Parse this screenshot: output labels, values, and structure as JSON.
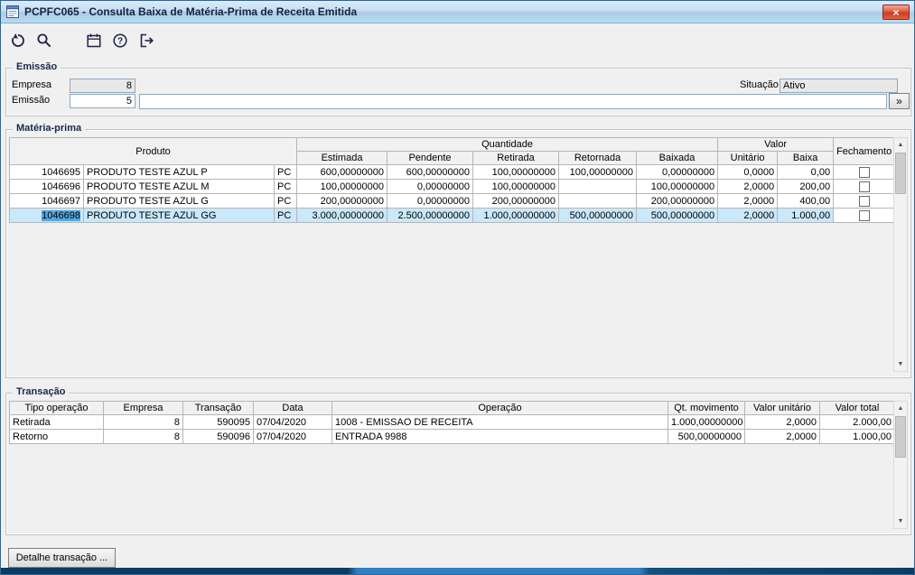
{
  "window": {
    "title": "PCPFC065 - Consulta Baixa de Matéria-Prima de Receita Emitida",
    "close_glyph": "×"
  },
  "toolbar": {
    "buttons": [
      "undo",
      "search",
      "calendar",
      "help",
      "exit"
    ]
  },
  "ui": {
    "expand_glyph": "»",
    "scroll_up_glyph": "▲",
    "scroll_down_glyph": "▼"
  },
  "emissao": {
    "group_label": "Emissão",
    "empresa_label": "Empresa",
    "empresa_value": "8",
    "emissao_label": "Emissão",
    "emissao_value": "5",
    "situacao_label": "Situação",
    "situacao_value": "Ativo",
    "descricao_value": ""
  },
  "materia_prima": {
    "group_label": "Matéria-prima",
    "headers": {
      "produto": "Produto",
      "quantidade": "Quantidade",
      "valor": "Valor",
      "fechamento": "Fechamento",
      "sub": [
        "Estimada",
        "Pendente",
        "Retirada",
        "Retornada",
        "Baixada",
        "Unitário",
        "Baixa"
      ]
    },
    "selected_row_index": 3,
    "rows": [
      {
        "codigo": "1046695",
        "produto": "PRODUTO TESTE AZUL P",
        "um": "PC",
        "estimada": "600,00000000",
        "pendente": "600,00000000",
        "retirada": "100,00000000",
        "retornada": "100,00000000",
        "baixada": "0,00000000",
        "unitario": "0,0000",
        "baixa": "0,00",
        "fechamento_checked": false
      },
      {
        "codigo": "1046696",
        "produto": "PRODUTO TESTE AZUL M",
        "um": "PC",
        "estimada": "100,00000000",
        "pendente": "0,00000000",
        "retirada": "100,00000000",
        "retornada": "",
        "baixada": "100,00000000",
        "unitario": "2,0000",
        "baixa": "200,00",
        "fechamento_checked": false
      },
      {
        "codigo": "1046697",
        "produto": "PRODUTO TESTE AZUL G",
        "um": "PC",
        "estimada": "200,00000000",
        "pendente": "0,00000000",
        "retirada": "200,00000000",
        "retornada": "",
        "baixada": "200,00000000",
        "unitario": "2,0000",
        "baixa": "400,00",
        "fechamento_checked": false
      },
      {
        "codigo": "1046698",
        "produto": "PRODUTO TESTE AZUL GG",
        "um": "PC",
        "estimada": "3.000,00000000",
        "pendente": "2.500,00000000",
        "retirada": "1.000,00000000",
        "retornada": "500,00000000",
        "baixada": "500,00000000",
        "unitario": "2,0000",
        "baixa": "1.000,00",
        "fechamento_checked": false
      }
    ]
  },
  "transacao": {
    "group_label": "Transação",
    "headers": [
      "Tipo operação",
      "Empresa",
      "Transação",
      "Data",
      "Operação",
      "Qt. movimento",
      "Valor unitário",
      "Valor total"
    ],
    "rows": [
      {
        "tipo": "Retirada",
        "empresa": "8",
        "transacao": "590095",
        "data": "07/04/2020",
        "operacao": "1008 - EMISSAO DE RECEITA",
        "qt_movimento": "1.000,00000000",
        "valor_unitario": "2,0000",
        "valor_total": "2.000,00"
      },
      {
        "tipo": "Retorno",
        "empresa": "8",
        "transacao": "590096",
        "data": "07/04/2020",
        "operacao": "ENTRADA 9988",
        "qt_movimento": "500,00000000",
        "valor_unitario": "2,0000",
        "valor_total": "1.000,00"
      }
    ]
  },
  "footer": {
    "detalhe_button_label": "Detalhe transação ..."
  }
}
